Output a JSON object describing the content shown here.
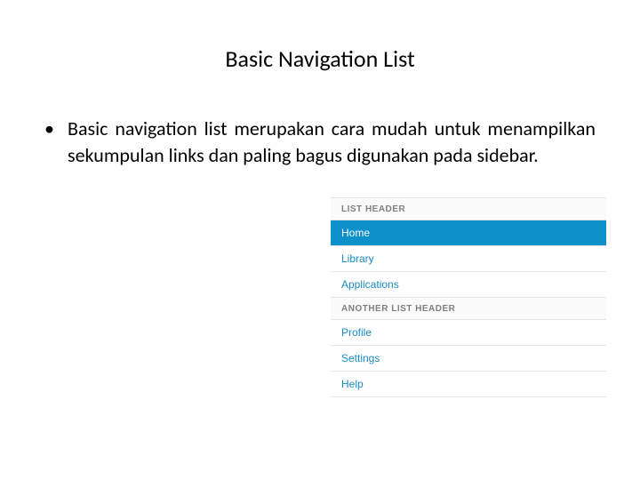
{
  "title": "Basic Navigation List",
  "bullet": {
    "marker": "•",
    "text": "Basic navigation list merupakan cara mudah untuk menampilkan sekumpulan links dan paling bagus digunakan pada sidebar."
  },
  "navlist": {
    "header1": "LIST HEADER",
    "items1": {
      "home": "Home",
      "library": "Library",
      "applications": "Applications"
    },
    "header2": "ANOTHER LIST HEADER",
    "items2": {
      "profile": "Profile",
      "settings": "Settings",
      "help": "Help"
    }
  }
}
